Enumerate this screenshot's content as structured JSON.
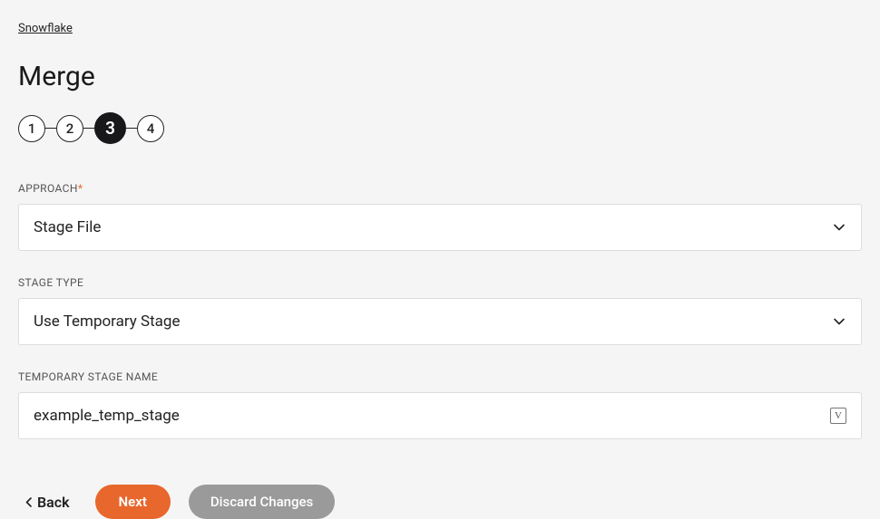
{
  "breadcrumb": {
    "label": "Snowflake"
  },
  "page": {
    "title": "Merge"
  },
  "stepper": {
    "steps": [
      "1",
      "2",
      "3",
      "4"
    ],
    "active_index": 2
  },
  "form": {
    "approach": {
      "label": "APPROACH",
      "required": true,
      "selected": "Stage File"
    },
    "stage_type": {
      "label": "STAGE TYPE",
      "required": false,
      "selected": "Use Temporary Stage"
    },
    "temp_stage_name": {
      "label": "TEMPORARY STAGE NAME",
      "required": false,
      "value": "example_temp_stage",
      "badge": "V"
    }
  },
  "buttons": {
    "back": "Back",
    "next": "Next",
    "discard": "Discard Changes"
  }
}
